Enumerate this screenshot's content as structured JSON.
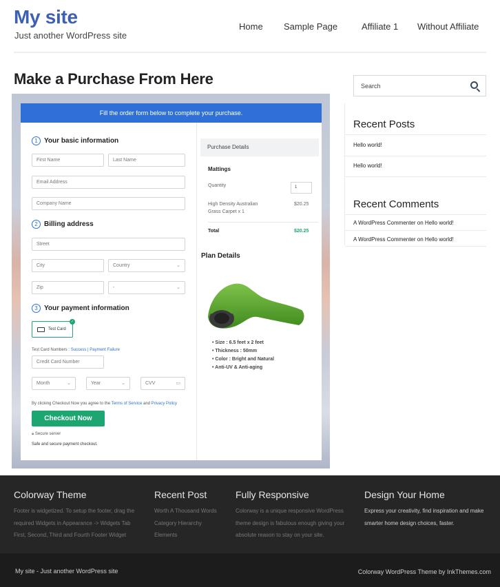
{
  "site": {
    "title": "My site",
    "tagline": "Just another WordPress site"
  },
  "nav": {
    "items": [
      "Home",
      "Sample Page",
      "Affiliate 1",
      "Without Affiliate"
    ]
  },
  "page": {
    "title": "Make a Purchase From Here"
  },
  "checkout": {
    "banner": "Fill the order form below to complete your purchase.",
    "sec1": "Your basic information",
    "sec2": "Billing address",
    "sec3": "Your payment information",
    "n1": "1",
    "n2": "2",
    "n3": "3",
    "first_name": "First Name",
    "last_name": "Last Name",
    "email": "Email Address",
    "company": "Company Name",
    "street": "Street",
    "city": "City",
    "country": "Country",
    "zip": "Zip",
    "state": "-",
    "test_card": "Test Card",
    "test_numbers_prefix": "Test Card Numbers : ",
    "success": "Success",
    "sep": " | ",
    "failure": "Payment Failure",
    "card_number": "Credit Card Number",
    "month": "Month",
    "year": "Year",
    "cvv": "CVV",
    "terms_prefix": "By clicking Checkout Now you agree to the ",
    "terms": "Terms of Service",
    "and": " and ",
    "privacy": "Privacy Policy",
    "button": "Checkout Now",
    "secure": "Secure server",
    "safe": "Safe and secure payment checkout."
  },
  "purchase": {
    "head": "Purchase Details",
    "product": "Mattings",
    "qty_label": "Quantity",
    "qty": "1",
    "item_l1": "High Density Australian",
    "item_l2": "Grass Carpet x 1",
    "item_price": "$20.25",
    "total_label": "Total",
    "total": "$20.25",
    "total_color": "#1ea672"
  },
  "plan": {
    "title": "Plan Details",
    "bullets": [
      "Size : 6.5 feet x 2 feet",
      "Thickness : 50mm",
      "Color : Bright and Natural",
      "Anti-UV & Anti-aging"
    ]
  },
  "sidebar": {
    "search_placeholder": "Search",
    "recent_posts_title": "Recent Posts",
    "posts": [
      "Hello world!",
      "Hello world!"
    ],
    "recent_comments_title": "Recent Comments",
    "comments": [
      {
        "author": "A WordPress Commenter",
        "on": " on ",
        "post": "Hello world!"
      },
      {
        "author": "A WordPress Commenter",
        "on": " on ",
        "post": "Hello world!"
      }
    ]
  },
  "footer": {
    "col1": {
      "title": "Colorway Theme",
      "lines": [
        "Footer is widgetized. To setup the footer, drag the",
        "required Widgets in Appearance -> Widgets Tab",
        "First, Second, Third and Fourth Footer Widget"
      ]
    },
    "col2": {
      "title": "Recent Post",
      "lines": [
        "Worth A Thousand Words",
        "Category Hierarchy",
        "Elements"
      ]
    },
    "col3": {
      "title": "Fully Responsive",
      "lines": [
        "Colorway is a unique responsive WordPress",
        "theme design is fabulous enough giving your",
        "absolute reason to stay on your site."
      ]
    },
    "col4": {
      "title": "Design Your Home",
      "lines": [
        "Express your creativity, find inspiration and make",
        "smarter home design choices, faster."
      ]
    },
    "bottom_left": "My site - Just another WordPress site",
    "bottom_right": "Colorway WordPress Theme by InkThemes.com"
  },
  "colors": {
    "accent": "#2e6fd8",
    "brand": "#3e5fb3",
    "button": "#1ea672",
    "footer": "#262626"
  }
}
